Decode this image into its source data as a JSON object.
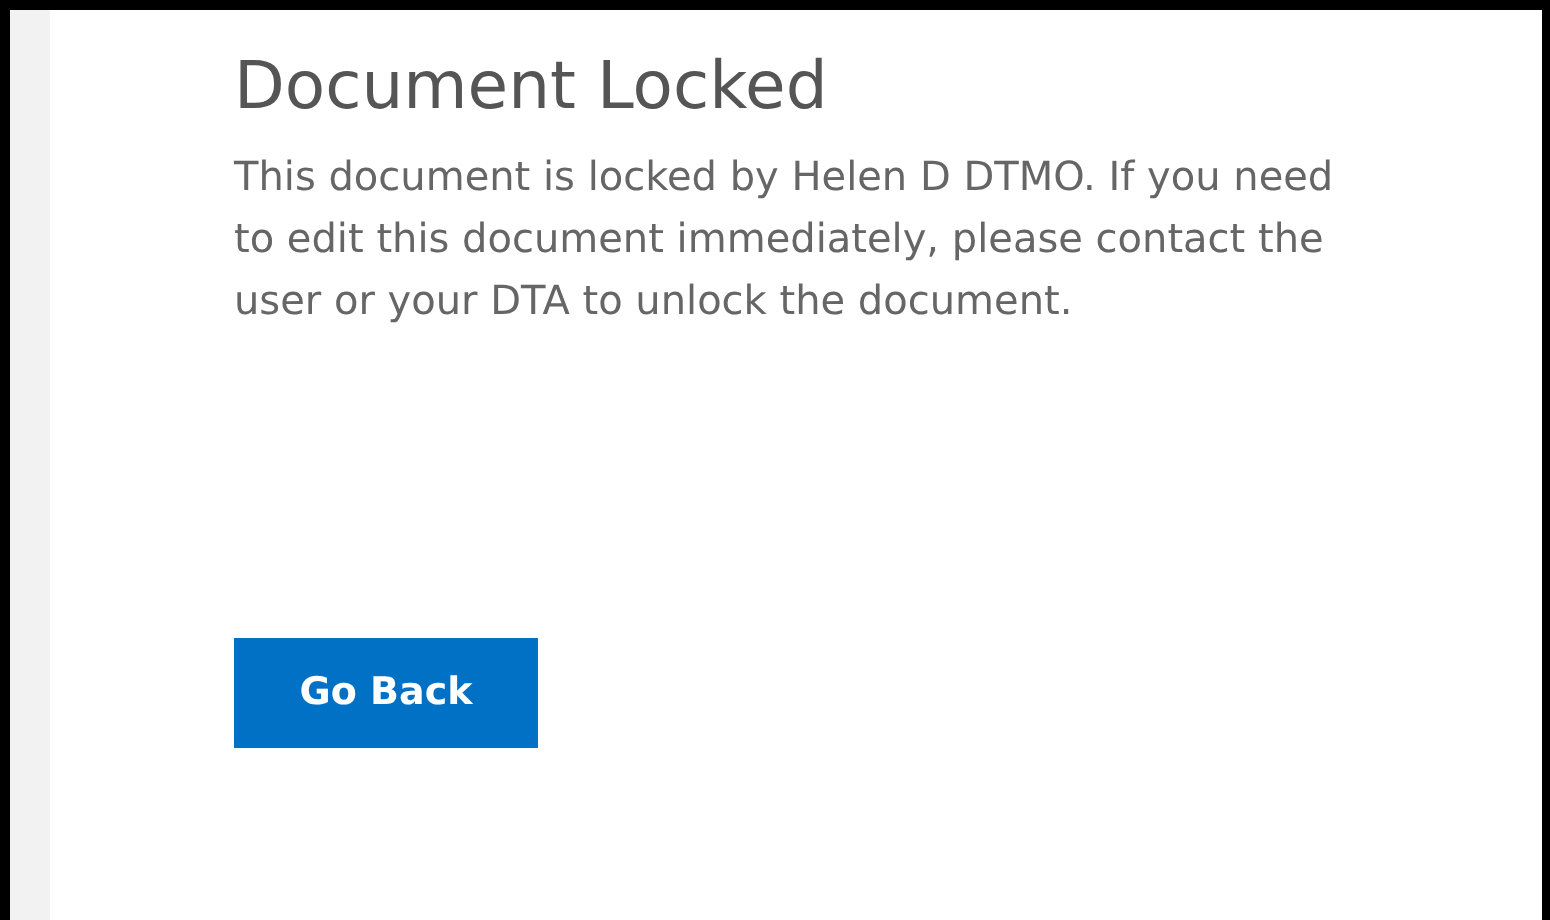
{
  "title": "Document Locked",
  "message": "This document is locked by Helen D DTMO. If you need to edit this document immediately, please contact the user or your DTA to unlock the document.",
  "buttons": [
    {
      "label": "Go Back"
    }
  ]
}
